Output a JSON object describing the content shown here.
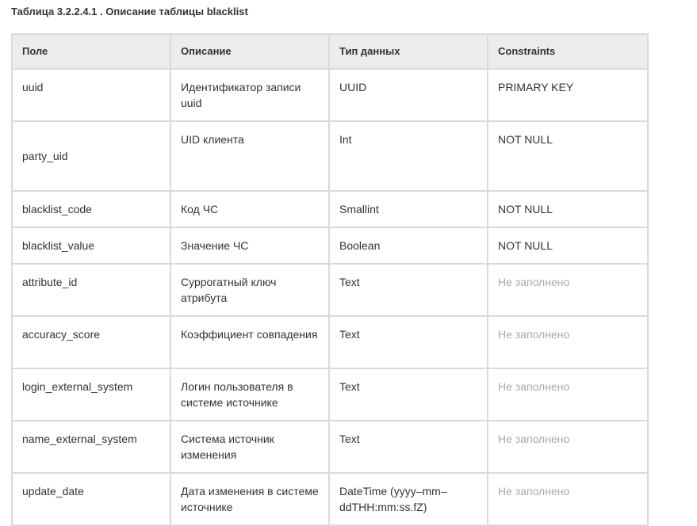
{
  "caption": "Таблица 3.2.2.4.1 . Описание таблицы blacklist",
  "table": {
    "headers": [
      "Поле",
      "Описание",
      "Тип данных",
      "Constraints"
    ],
    "rows": [
      {
        "field": "uuid",
        "description": "Идентификатор записи uuid",
        "type": "UUID",
        "constraints": "PRIMARY KEY",
        "empty": false
      },
      {
        "field": "party_uid",
        "description": "UID клиента",
        "type": "Int",
        "constraints": "NOT NULL",
        "empty": false
      },
      {
        "field": "blacklist_code",
        "description": "Код ЧС",
        "type": "Smallint",
        "constraints": "NOT NULL",
        "empty": false
      },
      {
        "field": "blacklist_value",
        "description": "Значение ЧС",
        "type": "Boolean",
        "constraints": "NOT NULL",
        "empty": false
      },
      {
        "field": "attribute_id",
        "description": "Суррогатный ключ атрибута",
        "type": "Text",
        "constraints": "Не заполнено",
        "empty": true
      },
      {
        "field": "accuracy_score",
        "description": "Коэффициент совпадения",
        "type": "Text",
        "constraints": "Не заполнено",
        "empty": true
      },
      {
        "field": "login_external_system",
        "description": "Логин пользователя в системе источнике",
        "type": "Text",
        "constraints": "Не заполнено",
        "empty": true
      },
      {
        "field": "name_external_system",
        "description": "Система источник изменения",
        "type": "Text",
        "constraints": "Не заполнено",
        "empty": true
      },
      {
        "field": "update_date",
        "description": "Дата изменения в системе источнике",
        "type": "DateTime (yyyy–mm–ddTHH:mm:ss.fZ)",
        "constraints": "Не заполнено",
        "empty": true
      }
    ]
  },
  "colors": {
    "header_bg": "#ececec",
    "border": "#dadada",
    "placeholder_text": "#a8a8a8",
    "text": "#333333"
  }
}
